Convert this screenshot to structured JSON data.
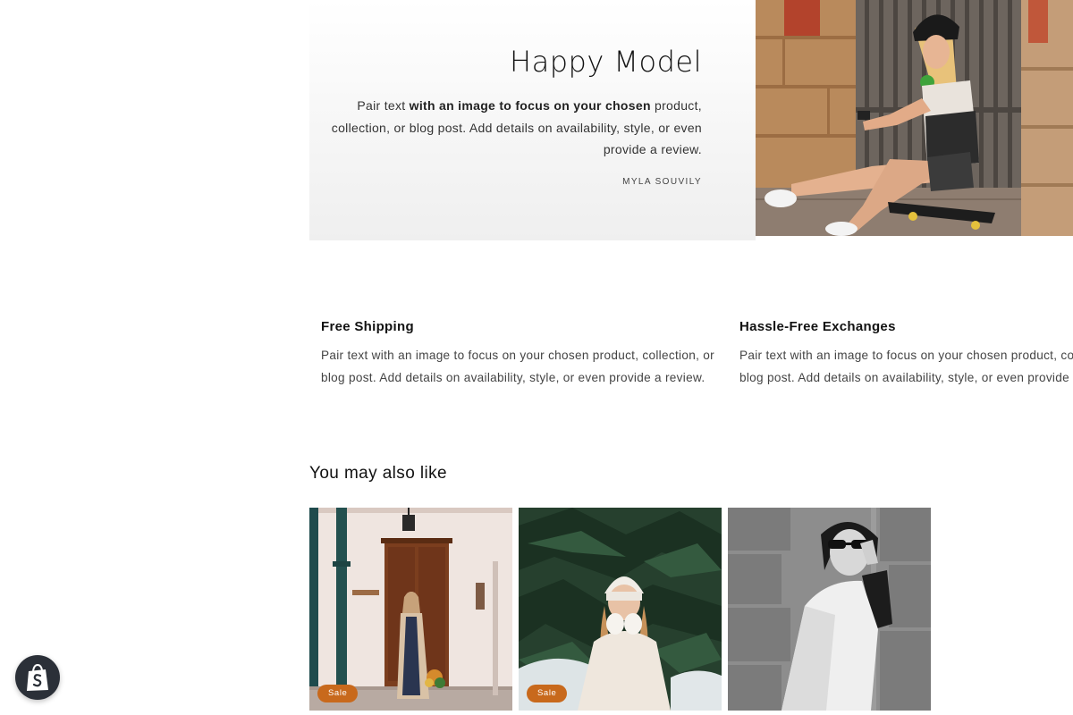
{
  "testimonial": {
    "title": "Happy Model",
    "body_start": "Pair text ",
    "body_bold": "with an image to focus on your chosen",
    "body_end": " product, collection, or blog post. Add details on availability, style, or even provide a review.",
    "author": "MYLA SOUVILY",
    "image_icon": "photo-skater-woman-icon"
  },
  "features": [
    {
      "title": "Free Shipping",
      "lines": [
        "Pair text with an image to focus on your chosen product, collection, or",
        "blog post. Add details on availability, style, or even provide a review."
      ]
    },
    {
      "title": "Hassle-Free Exchanges",
      "lines": [
        "Pair text with an image to focus on your chosen product, collection, or",
        "blog post. Add details on availability, style, or even provide a review."
      ]
    }
  ],
  "related": {
    "heading": "You may also like",
    "products": [
      {
        "image_icon": "photo-woman-coat-corridor-icon",
        "badge": "Sale"
      },
      {
        "image_icon": "photo-woman-winter-hat-icon",
        "badge": "Sale"
      },
      {
        "image_icon": "photo-woman-sunglasses-bw-icon",
        "badge": ""
      }
    ]
  },
  "shop_badge": {
    "icon": "shopify-bag-icon"
  },
  "colors": {
    "sale_badge": "#c8691c",
    "text": "#121212",
    "muted_text": "#444444",
    "shop_badge_bg": "#2b3038"
  }
}
